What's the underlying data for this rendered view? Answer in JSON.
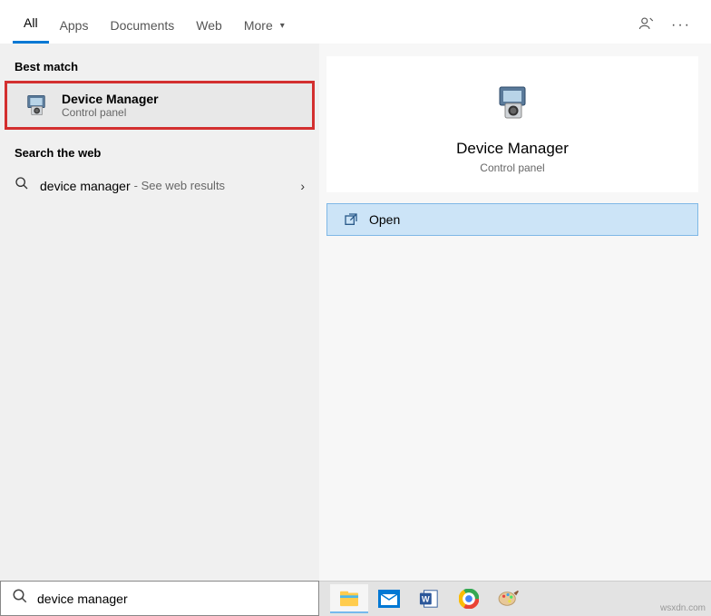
{
  "tabs": {
    "all": "All",
    "apps": "Apps",
    "documents": "Documents",
    "web": "Web",
    "more": "More"
  },
  "sections": {
    "best_match": "Best match",
    "search_web": "Search the web"
  },
  "best_match": {
    "title": "Device Manager",
    "subtitle": "Control panel"
  },
  "web_result": {
    "term": "device manager",
    "hint": "- See web results"
  },
  "preview": {
    "title": "Device Manager",
    "subtitle": "Control panel",
    "open": "Open"
  },
  "search": {
    "value": "device manager"
  },
  "watermark": "wsxdn.com"
}
